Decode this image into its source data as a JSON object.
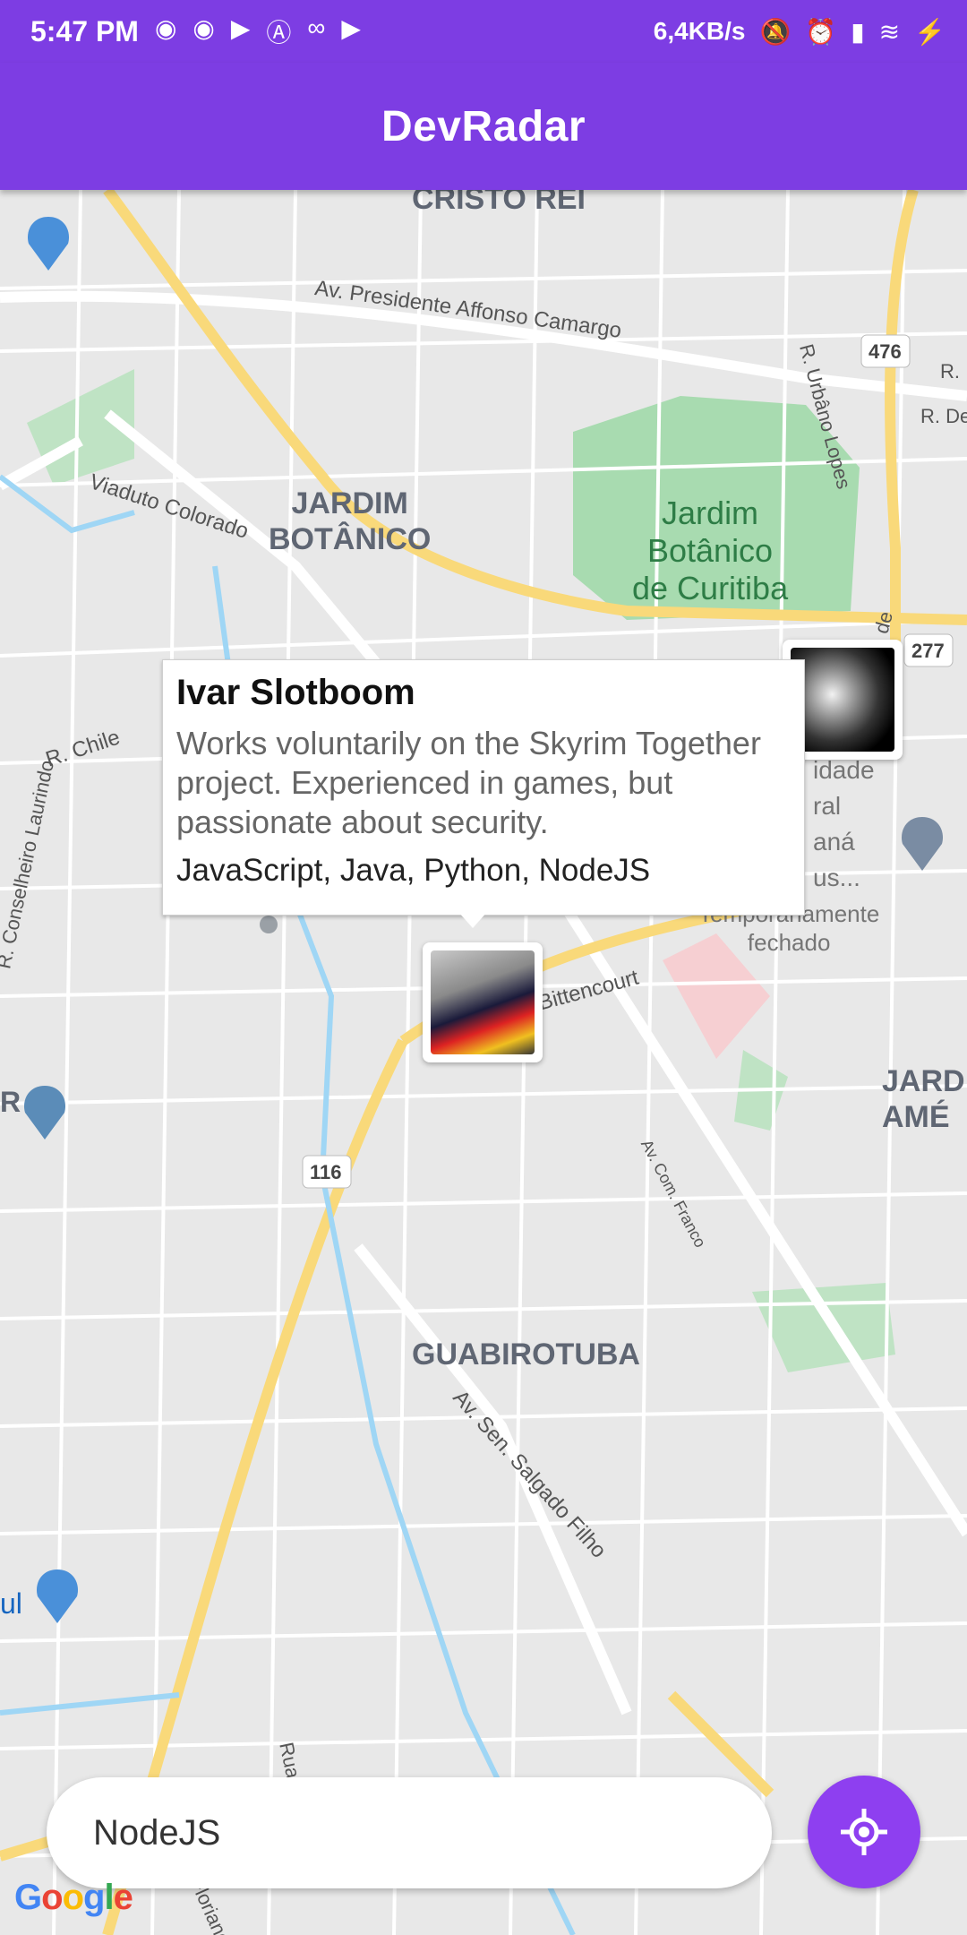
{
  "status_bar": {
    "time": "5:47 PM",
    "speed": "6,4KB/s",
    "left_icons": [
      "discord-icon",
      "discord-icon",
      "youtube-icon",
      "arc-icon",
      "voicemail-icon",
      "youtube-icon"
    ],
    "right_icons": [
      "bell-off-icon",
      "alarm-icon",
      "signal-icon",
      "wifi-icon",
      "charging-icon"
    ]
  },
  "app_bar": {
    "title": "DevRadar"
  },
  "map": {
    "districts": [
      "CRISTO REI",
      "JARDIM\nBOTÂNICO",
      "GUABIROTUBA",
      "JARD\nAMÉ"
    ],
    "park": "Jardim\nBotânico\nde Curitiba",
    "streets": {
      "affonso": "Av. Presidente Affonso Camargo",
      "viaduto": "Viaduto Colorado",
      "chile": "R. Chile",
      "laurindo": "R. Conselheiro Laurindo",
      "urbano": "R. Urbâno Lopes",
      "bittencourt": "Bittencourt",
      "franco": "Av. Com. Franco",
      "salgado": "Av. Sen. Salgado Filho",
      "floriano": "Av. Mal. Floriano P",
      "rua": "Rua",
      "r_del": "R. Del",
      "r_dot": "R."
    },
    "shields": [
      "476",
      "277",
      "116"
    ],
    "poi_university": [
      "idade",
      "ral",
      "aná",
      "us..."
    ],
    "poi_status": [
      "Temporariamente",
      "fechado"
    ],
    "edge_text_1": "de",
    "edge_text_2": "R",
    "edge_text_3": "ul"
  },
  "callout": {
    "name": "Ivar Slotboom",
    "bio": "Works voluntarily on the Skyrim Together project. Experienced in games, but passionate about security.",
    "techs": "JavaScript, Java, Python, NodeJS"
  },
  "search": {
    "value": "NodeJS"
  },
  "google_logo": "Google"
}
